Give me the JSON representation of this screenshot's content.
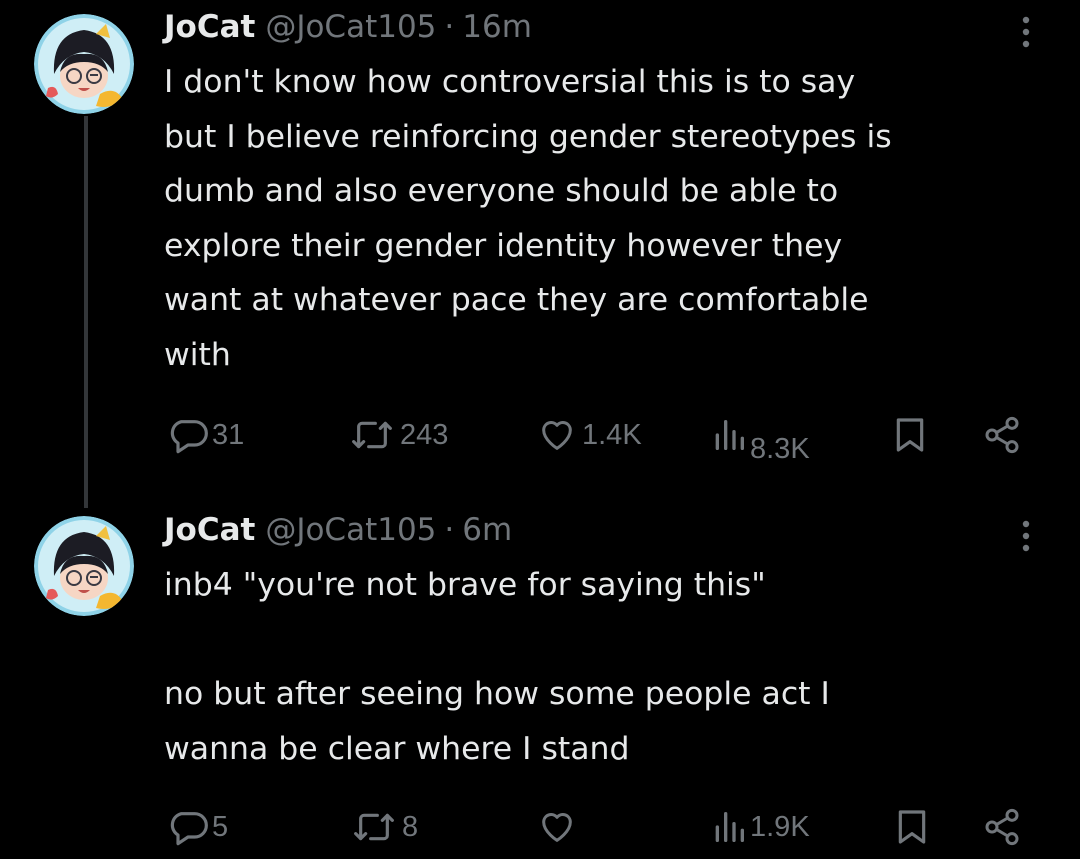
{
  "colors": {
    "background": "#000000",
    "text_primary": "#e7e9ea",
    "text_secondary": "#71767b",
    "thread_line": "#333639"
  },
  "tweets": [
    {
      "author_name": "JoCat",
      "handle": "@JoCat105",
      "separator": "·",
      "time": "16m",
      "text": "I don't know how controversial this is to say\nbut I believe reinforcing gender stereotypes is\ndumb and also everyone should be able to\nexplore their gender identity however they\nwant at whatever pace they are comfortable\nwith",
      "actions": {
        "replies": "31",
        "reposts": "243",
        "likes": "1.4K",
        "views": "8.3K"
      },
      "icons": [
        "reply-icon",
        "repost-icon",
        "like-icon",
        "views-icon",
        "bookmark-icon",
        "share-icon",
        "more-icon"
      ]
    },
    {
      "author_name": "JoCat",
      "handle": "@JoCat105",
      "separator": "·",
      "time": "6m",
      "text": "inb4 \"you're not brave for saying this\"\n\nno but after seeing how some people act I\nwanna be clear where I stand",
      "actions": {
        "replies": "5",
        "reposts": "8",
        "likes": "",
        "views": "1.9K"
      },
      "icons": [
        "reply-icon",
        "repost-icon",
        "like-icon",
        "views-icon",
        "bookmark-icon",
        "share-icon",
        "more-icon"
      ]
    }
  ]
}
